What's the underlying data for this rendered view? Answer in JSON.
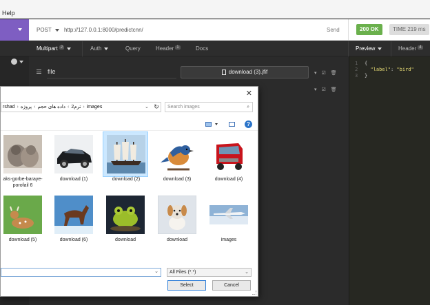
{
  "menubar": {
    "help": "Help"
  },
  "request": {
    "method": "POST",
    "url": "http://127.0.0.1:8000/predictcnn/",
    "send_label": "Send",
    "status": "200 OK",
    "time": "TIME 219 ms",
    "status_color": "#6ab04c",
    "accent_color": "#7e5ec2"
  },
  "tabs": {
    "body": {
      "label": "Multipart",
      "badge": "2"
    },
    "auth": {
      "label": "Auth"
    },
    "query": {
      "label": "Query"
    },
    "header": {
      "label": "Header",
      "badge": "1"
    },
    "docs": {
      "label": "Docs"
    },
    "preview": {
      "label": "Preview"
    },
    "resp_header": {
      "label": "Header",
      "badge": "4"
    }
  },
  "form": {
    "field_name": "file",
    "file_value": "download (3).jfif"
  },
  "response": {
    "lines": [
      "1",
      "2",
      "3"
    ],
    "open": "{",
    "key": "\"label\"",
    "colon": ":",
    "value": "\"bird\"",
    "close": "}"
  },
  "dialog": {
    "breadcrumb": [
      "rshad",
      "ترم2",
      "داده های حجم",
      "پروژه",
      "images"
    ],
    "search_placeholder": "Search images",
    "files": [
      {
        "name": "aks-gorbe-baraye-porofail 6",
        "icon": "cats-photo"
      },
      {
        "name": "download (1)",
        "icon": "car-photo"
      },
      {
        "name": "download (2)",
        "icon": "ship-photo",
        "selected": true
      },
      {
        "name": "download (3)",
        "icon": "bird-photo"
      },
      {
        "name": "download (4)",
        "icon": "truck-photo"
      },
      {
        "name": "download (5)",
        "icon": "deer-photo"
      },
      {
        "name": "download (6)",
        "icon": "horse-photo"
      },
      {
        "name": "download",
        "icon": "frog-photo"
      },
      {
        "name": "download",
        "icon": "puppy-photo"
      },
      {
        "name": "images",
        "icon": "airplane-photo"
      }
    ],
    "filename_value": "",
    "filter": "All Files (*.*)",
    "select_label": "Select",
    "cancel_label": "Cancel"
  }
}
